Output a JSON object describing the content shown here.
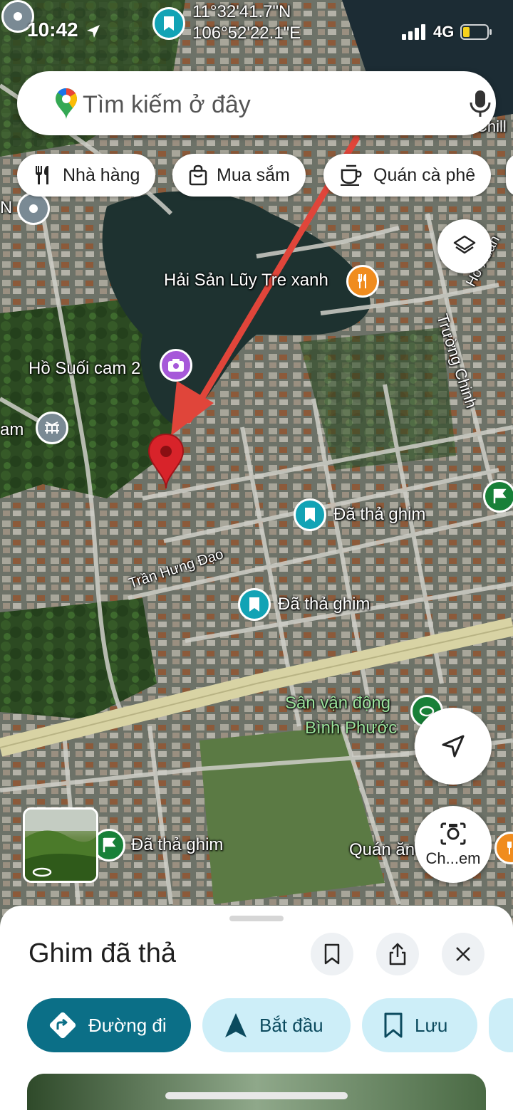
{
  "status_bar": {
    "time": "10:42",
    "network": "4G"
  },
  "coordinates": {
    "lat": "11°32'41.7\"N",
    "lng": "106°52'22.1\"E"
  },
  "search": {
    "placeholder": "Tìm kiếm ở đây"
  },
  "chips": [
    {
      "label": "Nhà hàng",
      "icon": "utensils-icon"
    },
    {
      "label": "Mua sắm",
      "icon": "shopping-bag-icon"
    },
    {
      "label": "Quán cà phê",
      "icon": "coffee-cup-icon"
    }
  ],
  "map_labels": {
    "restaurant": "Hải Sản Lũy Tre xanh",
    "lake": "Hồ Suối cam 2",
    "edge_left": "am",
    "edge_n": "N",
    "pin1": "Đã thả ghim",
    "pin2": "Đã thả ghim",
    "pin3": "Đã thả ghim",
    "road1": "Trần Hưng Đạo",
    "road2": "Trường Chinh",
    "road3": "Hồ Xuân",
    "stadium_line1": "Sân vận động",
    "stadium_line2": "Bình Phước",
    "food": "Quán ăn",
    "top_right": "Chill"
  },
  "fabs": {
    "camera_label": "Ch...em"
  },
  "sheet": {
    "title": "Ghim đã thả",
    "actions": [
      {
        "label": "Đường đi",
        "icon": "directions-icon"
      },
      {
        "label": "Bắt đầu",
        "icon": "navigation-arrow-icon"
      },
      {
        "label": "Lưu",
        "icon": "bookmark-icon"
      }
    ]
  },
  "colors": {
    "accent": "#0b6f87",
    "accent_light": "#cdeef8",
    "pin_red": "#d8232a",
    "annotation_arrow": "#e0453a",
    "poi_teal": "#12a3b5",
    "poi_green": "#188038",
    "poi_orange": "#f08c1e",
    "poi_purple": "#a658d9"
  }
}
